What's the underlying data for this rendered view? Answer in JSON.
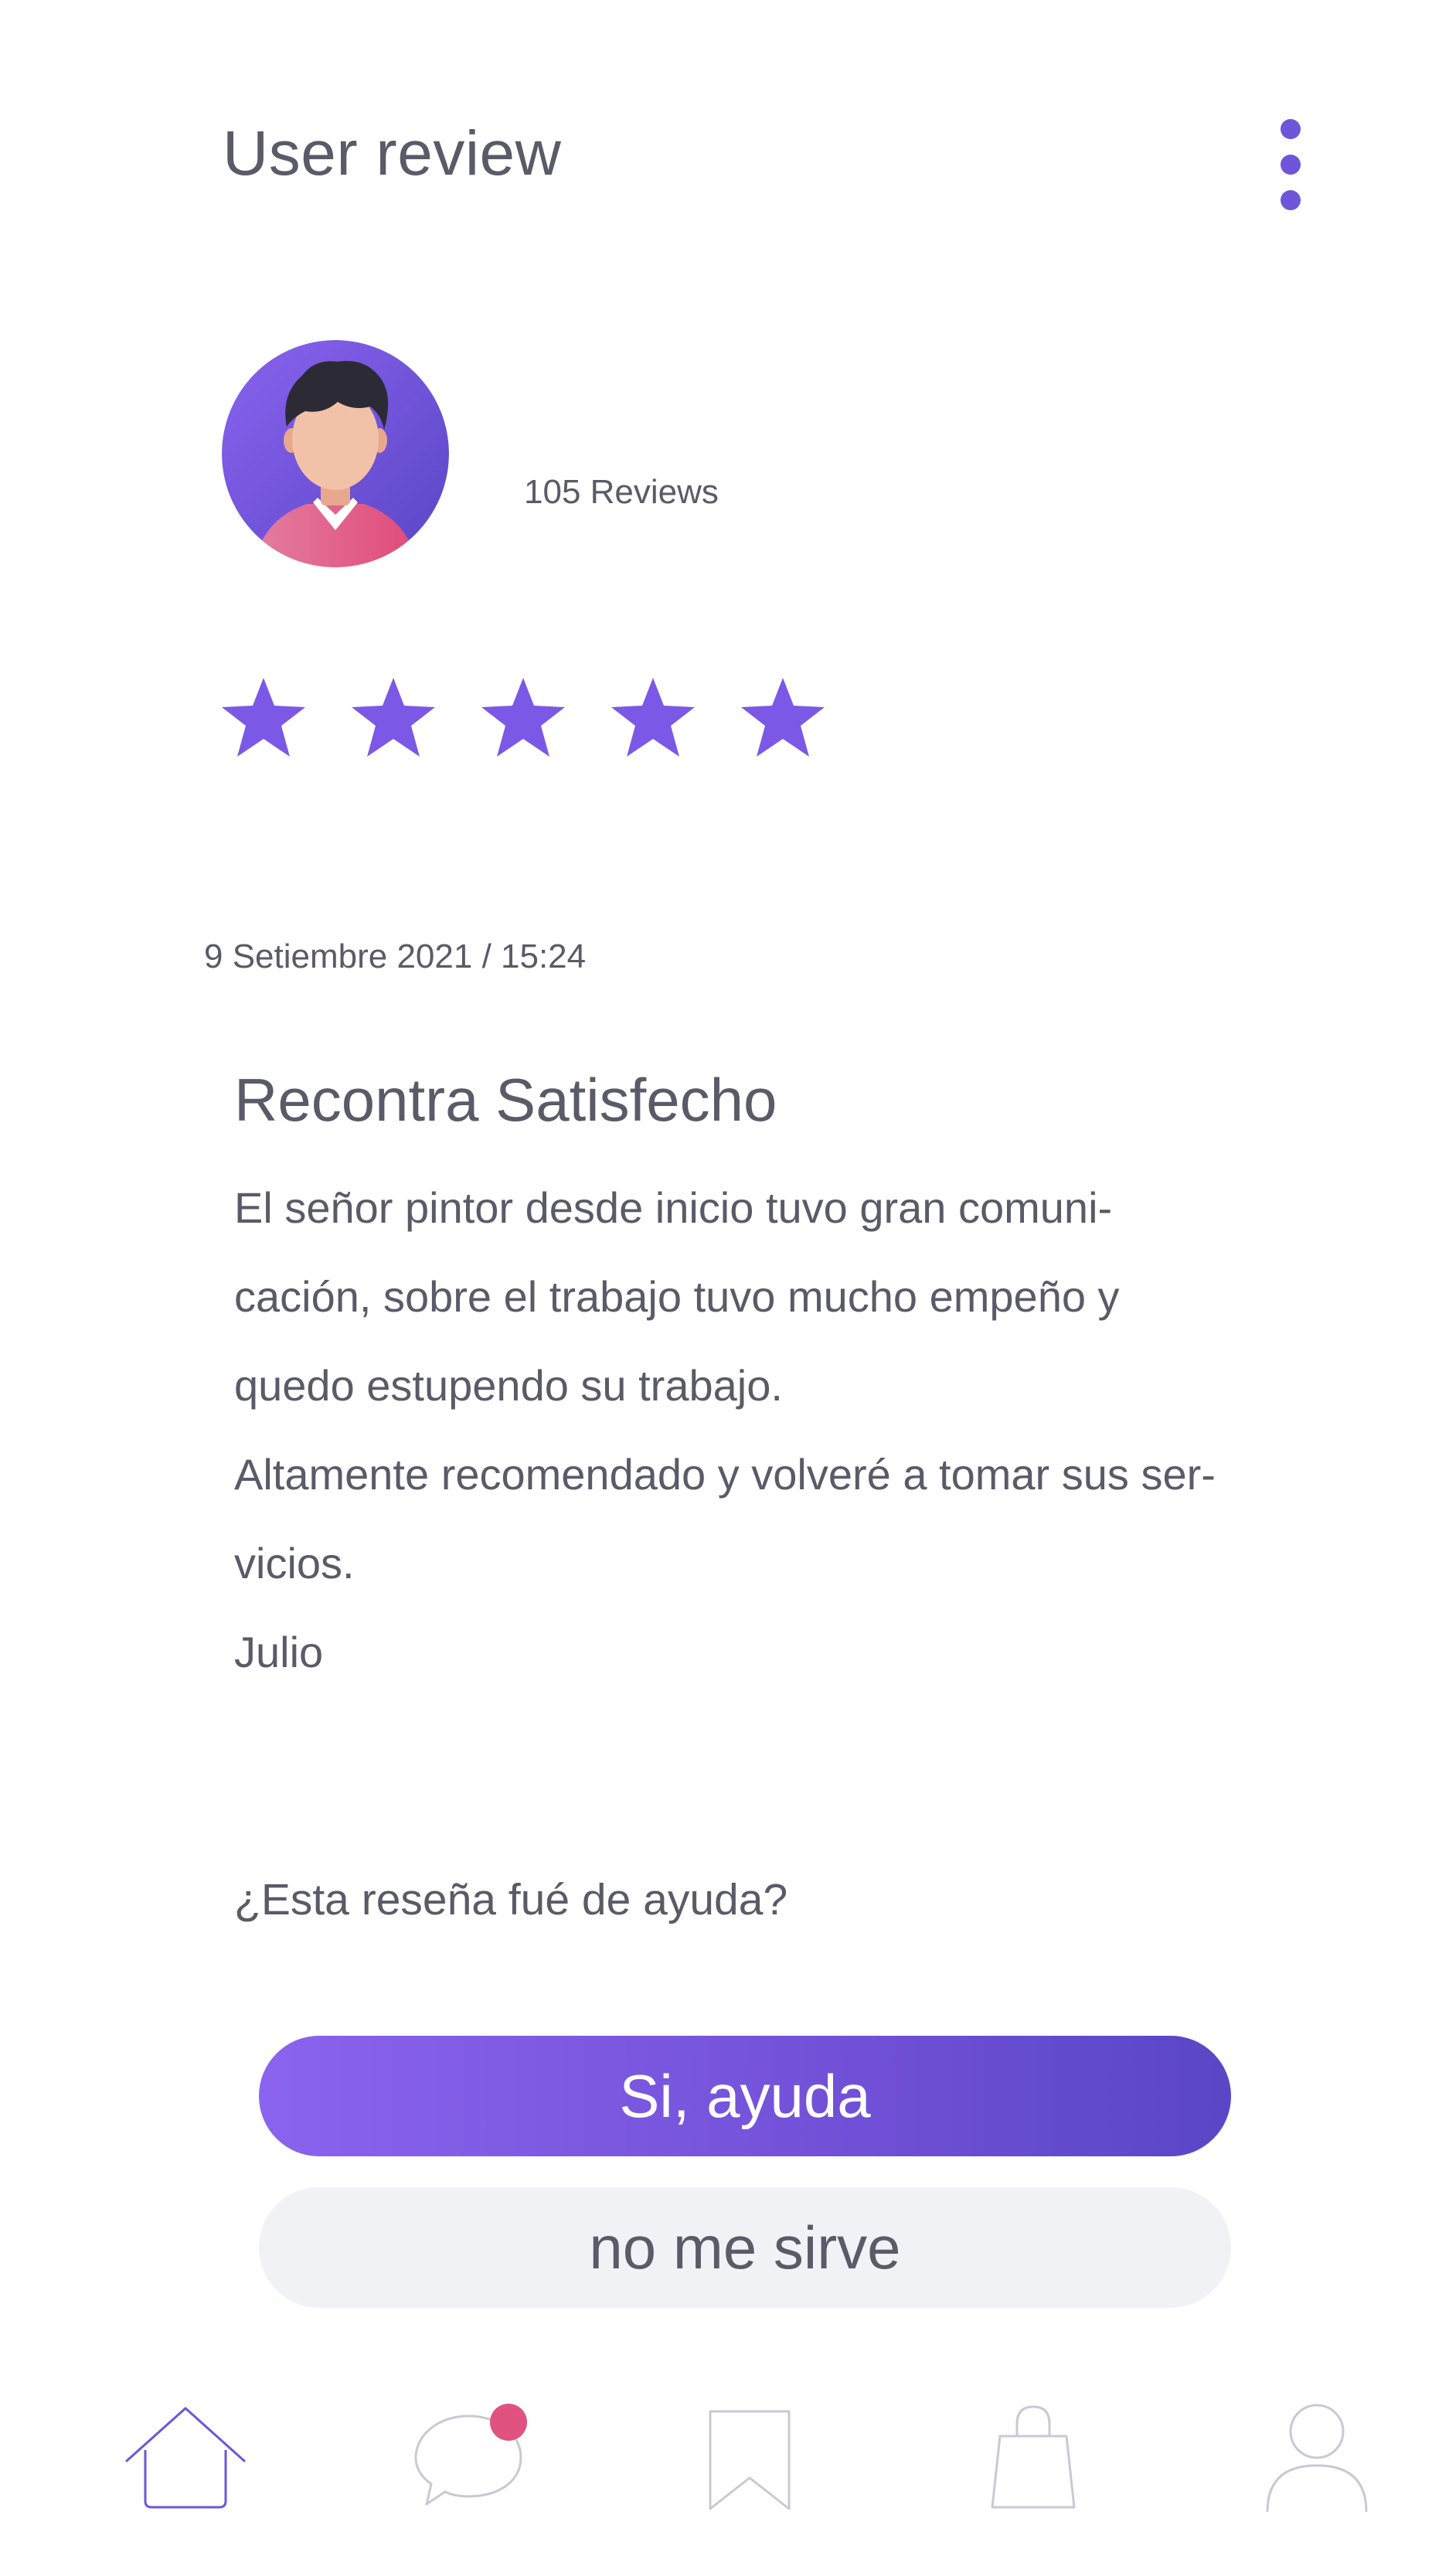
{
  "header": {
    "title": "User review",
    "menu_icon": "more-vertical-icon"
  },
  "colors": {
    "accent": "#6e55d9",
    "accent_light": "#8a63ee",
    "notification": "#e05280",
    "text": "#5b5a68",
    "secondary_button_bg": "#f1f2f5"
  },
  "reviewer": {
    "avatar_icon": "user-avatar",
    "reviews_count": "105 Reviews"
  },
  "rating": {
    "stars": 5,
    "max": 5
  },
  "review": {
    "date": "9 Setiembre 2021 / 15:24",
    "title": "Recontra Satisfecho",
    "lines": [
      "El señor pintor desde inicio tuvo gran comuni-",
      "cación, sobre el trabajo tuvo mucho empeño y",
      "quedo estupendo su trabajo.",
      "Altamente recomendado y volveré a tomar sus ser-",
      "vicios.",
      "Julio"
    ]
  },
  "feedback": {
    "question": "¿Esta reseña fué de ayuda?",
    "yes_label": "Si, ayuda",
    "no_label": "no me sirve"
  },
  "bottom_nav": {
    "items": [
      "home-icon",
      "chat-icon",
      "bookmark-icon",
      "shopping-bag-icon",
      "profile-icon"
    ],
    "active": "home-icon",
    "chat_has_notification": true
  }
}
